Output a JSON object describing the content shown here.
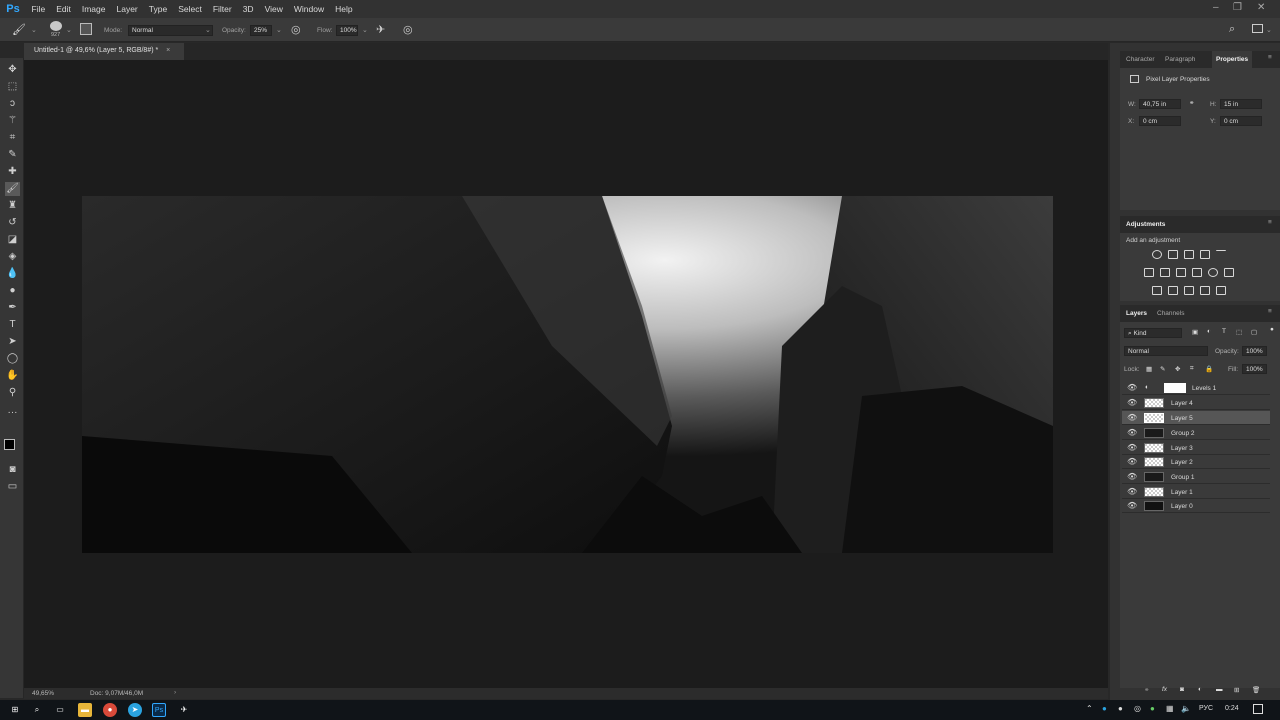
{
  "app": {
    "logo": "Ps",
    "menus": [
      "File",
      "Edit",
      "Image",
      "Layer",
      "Type",
      "Select",
      "Filter",
      "3D",
      "View",
      "Window",
      "Help"
    ]
  },
  "options": {
    "brush_size": "927",
    "mode_label": "Mode:",
    "mode_value": "Normal",
    "opacity_label": "Opacity:",
    "opacity_value": "25%",
    "flow_label": "Flow:",
    "flow_value": "100%"
  },
  "document": {
    "tab_title": "Untitled-1 @ 49,6% (Layer 5, RGB/8#) *",
    "close": "×",
    "zoom": "49,65%",
    "doc_info": "Doc: 9,07M/46,0M"
  },
  "properties_panel": {
    "tabs": [
      "Character",
      "Paragraph",
      "Properties"
    ],
    "active_tab": "Properties",
    "heading": "Pixel Layer Properties",
    "w_label": "W:",
    "w_value": "40,75 in",
    "h_label": "H:",
    "h_value": "15 in",
    "x_label": "X:",
    "x_value": "0 cm",
    "y_label": "Y:",
    "y_value": "0 cm"
  },
  "adjustments_panel": {
    "title": "Adjustments",
    "subtitle": "Add an adjustment"
  },
  "layers_panel": {
    "tabs": [
      "Layers",
      "Channels"
    ],
    "filter_kind": "Kind",
    "blend_mode": "Normal",
    "opacity_label": "Opacity:",
    "opacity_value": "100%",
    "lock_label": "Lock:",
    "fill_label": "Fill:",
    "fill_value": "100%",
    "layers": [
      {
        "name": "Levels 1",
        "type": "adjustment"
      },
      {
        "name": "Layer 4",
        "type": "pixel"
      },
      {
        "name": "Layer 5",
        "type": "pixel",
        "selected": true
      },
      {
        "name": "Group 2",
        "type": "group"
      },
      {
        "name": "Layer 3",
        "type": "pixel"
      },
      {
        "name": "Layer 2",
        "type": "pixel"
      },
      {
        "name": "Group 1",
        "type": "group"
      },
      {
        "name": "Layer 1",
        "type": "pixel"
      },
      {
        "name": "Layer 0",
        "type": "pixel"
      }
    ]
  },
  "taskbar": {
    "lang": "РУС",
    "time": "0:24"
  },
  "colors": {
    "accent": "#31a8ff",
    "canvas_bg": "#1c1c1c",
    "panel_bg": "#3a3a3a"
  }
}
